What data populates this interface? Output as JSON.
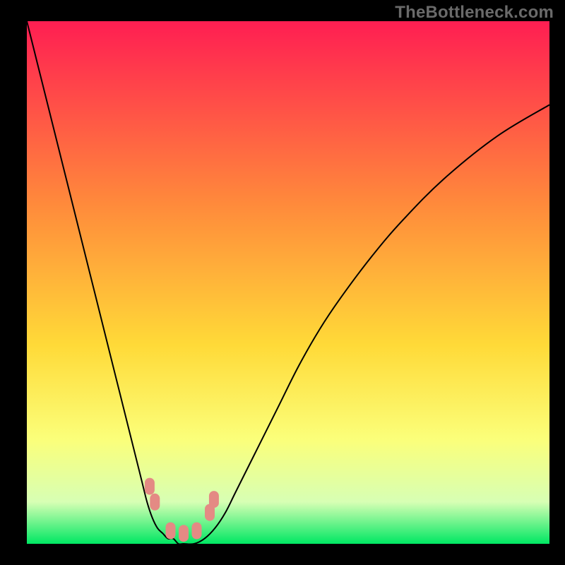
{
  "watermark": "TheBottleneck.com",
  "chart_data": {
    "type": "line",
    "title": "",
    "xlabel": "",
    "ylabel": "",
    "xlim": [
      0,
      100
    ],
    "ylim": [
      0,
      100
    ],
    "grid": false,
    "legend": "none",
    "background_gradient": {
      "stops": [
        {
          "offset": 0.0,
          "color": "#ff1e52"
        },
        {
          "offset": 0.35,
          "color": "#ff8a3b"
        },
        {
          "offset": 0.62,
          "color": "#ffda38"
        },
        {
          "offset": 0.8,
          "color": "#fbff7a"
        },
        {
          "offset": 0.92,
          "color": "#d7ffb4"
        },
        {
          "offset": 1.0,
          "color": "#00e763"
        }
      ]
    },
    "series": [
      {
        "name": "curve",
        "color": "#000000",
        "x": [
          0,
          2,
          4,
          6,
          8,
          10,
          12,
          14,
          16,
          18,
          20,
          21,
          22,
          23,
          24,
          25,
          26,
          27,
          28,
          29,
          30,
          32,
          34,
          36,
          38,
          40,
          44,
          48,
          52,
          56,
          60,
          66,
          72,
          80,
          90,
          100
        ],
        "y": [
          100,
          92,
          84,
          76,
          68,
          60,
          52,
          44,
          36,
          28,
          20,
          16,
          12,
          8,
          5,
          3,
          2,
          1,
          1,
          0,
          0,
          0,
          1,
          3,
          6,
          10,
          18,
          26,
          34,
          41,
          47,
          55,
          62,
          70,
          78,
          84
        ]
      }
    ],
    "markers": [
      {
        "name": "marker-left-upper",
        "color": "#e48a84",
        "x": 23.5,
        "y": 11.0
      },
      {
        "name": "marker-left-lower",
        "color": "#e48a84",
        "x": 24.5,
        "y": 8.0
      },
      {
        "name": "marker-bottom-1",
        "color": "#e48a84",
        "x": 27.5,
        "y": 2.5
      },
      {
        "name": "marker-bottom-2",
        "color": "#e48a84",
        "x": 30.0,
        "y": 2.0
      },
      {
        "name": "marker-bottom-3",
        "color": "#e48a84",
        "x": 32.5,
        "y": 2.5
      },
      {
        "name": "marker-right-lower",
        "color": "#e48a84",
        "x": 35.0,
        "y": 6.0
      },
      {
        "name": "marker-right-upper",
        "color": "#e48a84",
        "x": 35.8,
        "y": 8.5
      }
    ]
  }
}
